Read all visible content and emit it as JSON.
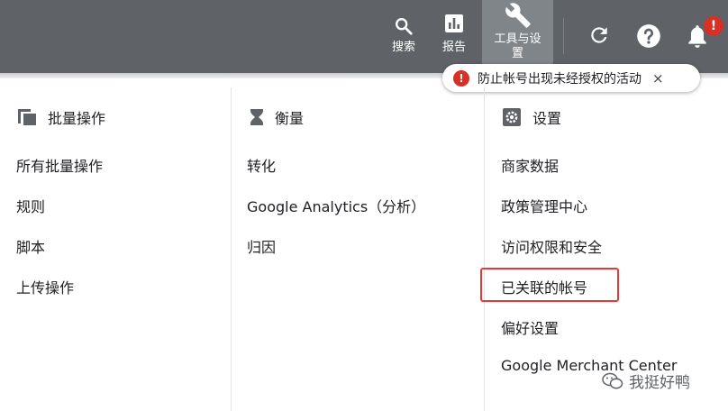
{
  "topbar": {
    "search_label": "搜索",
    "reports_label": "报告",
    "tools_label": "工具与设置",
    "refresh_icon": "refresh-icon",
    "help_icon": "help-icon",
    "bell_icon": "bell-icon",
    "notification_badge": "!"
  },
  "alert": {
    "icon": "!",
    "text": "防止帐号出现未经授权的活动",
    "close": "×"
  },
  "columns": [
    {
      "title": "批量操作",
      "icon": "copy-icon",
      "items": [
        "所有批量操作",
        "规则",
        "脚本",
        "上传操作"
      ]
    },
    {
      "title": "衡量",
      "icon": "hourglass-icon",
      "items": [
        "转化",
        "Google Analytics（分析）",
        "归因"
      ]
    },
    {
      "title": "设置",
      "icon": "gear-icon",
      "items": [
        "商家数据",
        "政策管理中心",
        "访问权限和安全",
        "已关联的帐号",
        "偏好设置",
        "Google Merchant Center"
      ]
    }
  ],
  "watermark": {
    "text": "我挺好鸭"
  },
  "colors": {
    "topbar": "#5f6368",
    "tools_active": "#80858a",
    "alert_red": "#d93025",
    "highlight": "#e53935"
  }
}
